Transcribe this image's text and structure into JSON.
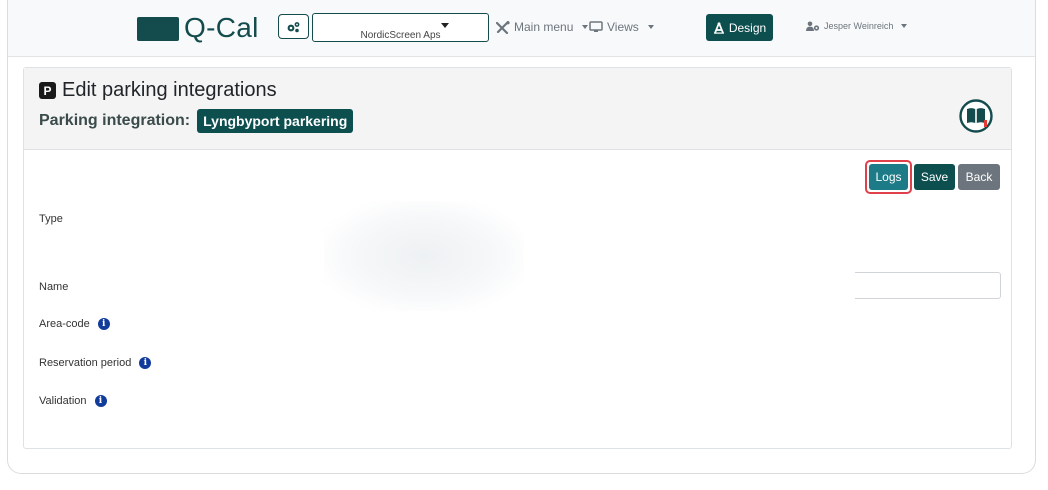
{
  "navbar": {
    "logo_text": "Q-Cal",
    "company_select": {
      "value": "NordicScreen Aps"
    },
    "main_menu_label": "Main menu",
    "views_label": "Views",
    "design_label": "Design",
    "user_label": "Jesper Weinreich",
    "icons": {
      "settings": "cogs-icon",
      "main_menu": "tools-icon",
      "views": "monitor-icon",
      "design": "drafting-compass-icon",
      "user": "user-cog-icon"
    }
  },
  "header": {
    "icon": "P",
    "title": "Edit parking integrations",
    "subtitle_label": "Parking integration:",
    "integration_name": "Lyngbyport parkering",
    "help_icon": "book-icon"
  },
  "actions": {
    "logs_label": "Logs",
    "save_label": "Save",
    "back_label": "Back"
  },
  "form": {
    "type_label": "Type",
    "name_label": "Name",
    "name_value": "",
    "area_code_label": "Area-code",
    "reservation_period_label": "Reservation period",
    "validation_label": "Validation",
    "info_glyph": "i"
  },
  "colors": {
    "brand": "#0d4f4f",
    "logs_button": "#1d7a87",
    "back_button": "#6c757d",
    "highlight_outline": "#e0404a",
    "info_icon": "#123c9c"
  }
}
